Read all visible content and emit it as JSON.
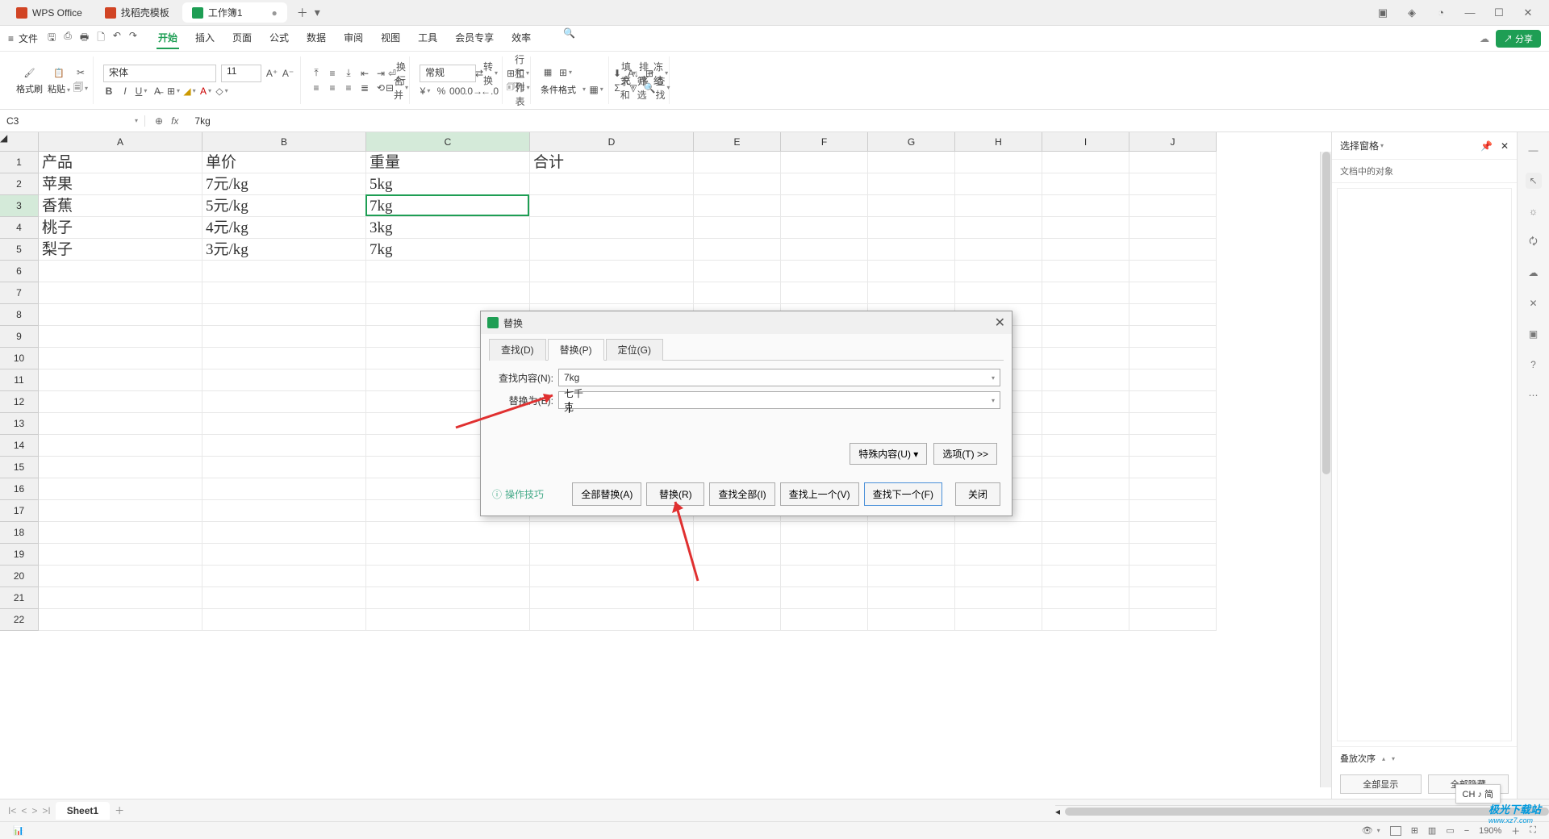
{
  "titlebar": {
    "tabs": [
      {
        "label": "WPS Office",
        "icon": "w"
      },
      {
        "label": "找稻壳模板",
        "icon": "d"
      },
      {
        "label": "工作簿1",
        "icon": "s",
        "active": true
      }
    ]
  },
  "menubar": {
    "file": "文件",
    "tabs": [
      "开始",
      "插入",
      "页面",
      "公式",
      "数据",
      "审阅",
      "视图",
      "工具",
      "会员专享",
      "效率"
    ],
    "active": "开始",
    "share": "分享"
  },
  "ribbon": {
    "format_painter": "格式刷",
    "paste": "粘贴",
    "font_name": "宋体",
    "font_size": "11",
    "wrap": "换行",
    "merge": "合并",
    "number_format": "常规",
    "convert": "转换",
    "rowcol": "行和列",
    "worksheet": "工作表",
    "cond_fmt": "条件格式",
    "fill": "填充",
    "sort": "排序",
    "freeze": "冻结",
    "sum": "求和",
    "filter": "筛选",
    "find": "查找"
  },
  "formula": {
    "cell_ref": "C3",
    "value": "7kg"
  },
  "grid": {
    "columns": [
      "A",
      "B",
      "C",
      "D",
      "E",
      "F",
      "G",
      "H",
      "I",
      "J"
    ],
    "row_count": 22,
    "selected_col": "C",
    "selected_row": 3,
    "data": [
      [
        "产品",
        "单价",
        "重量",
        "合计"
      ],
      [
        "苹果",
        "7元/kg",
        "5kg",
        ""
      ],
      [
        "香蕉",
        "5元/kg",
        "7kg",
        ""
      ],
      [
        "桃子",
        "4元/kg",
        "3kg",
        ""
      ],
      [
        "梨子",
        "3元/kg",
        "7kg",
        ""
      ]
    ]
  },
  "dialog": {
    "title": "替换",
    "tabs": [
      "查找(D)",
      "替换(P)",
      "定位(G)"
    ],
    "active_tab": "替换(P)",
    "find_label": "查找内容(N):",
    "find_value": "7kg",
    "replace_label": "替换为(E):",
    "replace_value": "七千克",
    "special": "特殊内容(U)",
    "options": "选项(T) >>",
    "help": "操作技巧",
    "buttons": {
      "replace_all": "全部替换(A)",
      "replace": "替换(R)",
      "find_all": "查找全部(I)",
      "find_prev": "查找上一个(V)",
      "find_next": "查找下一个(F)",
      "close": "关闭"
    }
  },
  "right_panel": {
    "title": "选择窗格",
    "subtitle": "文档中的对象",
    "order": "叠放次序",
    "show_all": "全部显示",
    "hide_all": "全部隐藏"
  },
  "sheets": {
    "active": "Sheet1"
  },
  "statusbar": {
    "zoom": "190%"
  },
  "ime": "CH ♪ 简",
  "watermark": {
    "main": "极光下载站",
    "sub": "www.xz7.com"
  }
}
